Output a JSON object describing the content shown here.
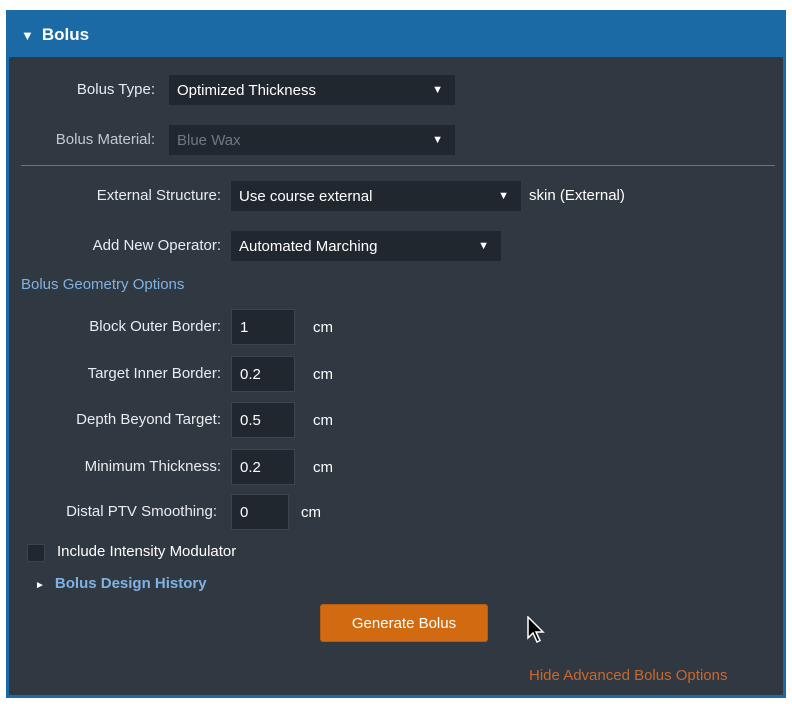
{
  "panel": {
    "title": "Bolus",
    "collapse_icon": "triangle-down-icon"
  },
  "bolus_type": {
    "label": "Bolus Type:",
    "value": "Optimized Thickness"
  },
  "bolus_material": {
    "label": "Bolus Material:",
    "value": "Blue Wax"
  },
  "external_structure": {
    "label": "External Structure:",
    "value": "Use course external",
    "note": "skin (External)"
  },
  "add_new_operator": {
    "label": "Add New Operator:",
    "value": "Automated Marching"
  },
  "geometry": {
    "title": "Bolus Geometry Options",
    "fields": [
      {
        "label": "Block Outer Border:",
        "value": "1",
        "unit": "cm"
      },
      {
        "label": "Target Inner Border:",
        "value": "0.2",
        "unit": "cm"
      },
      {
        "label": "Depth Beyond Target:",
        "value": "0.5",
        "unit": "cm"
      },
      {
        "label": "Minimum Thickness:",
        "value": "0.2",
        "unit": "cm"
      },
      {
        "label": "Distal PTV Smoothing:",
        "value": "0",
        "unit": "cm"
      }
    ]
  },
  "intensity_modulator": {
    "label": "Include Intensity Modulator",
    "checked": false
  },
  "design_history": {
    "label": "Bolus Design History",
    "icon": "triangle-right-icon"
  },
  "generate_button": {
    "label": "Generate Bolus"
  },
  "advanced_link": {
    "label": "Hide Advanced Bolus Options"
  },
  "colors": {
    "header": "#1b6aa6",
    "panel": "#303841",
    "button": "#d16a10",
    "link": "#c9672d",
    "section": "#7fb2e3"
  }
}
